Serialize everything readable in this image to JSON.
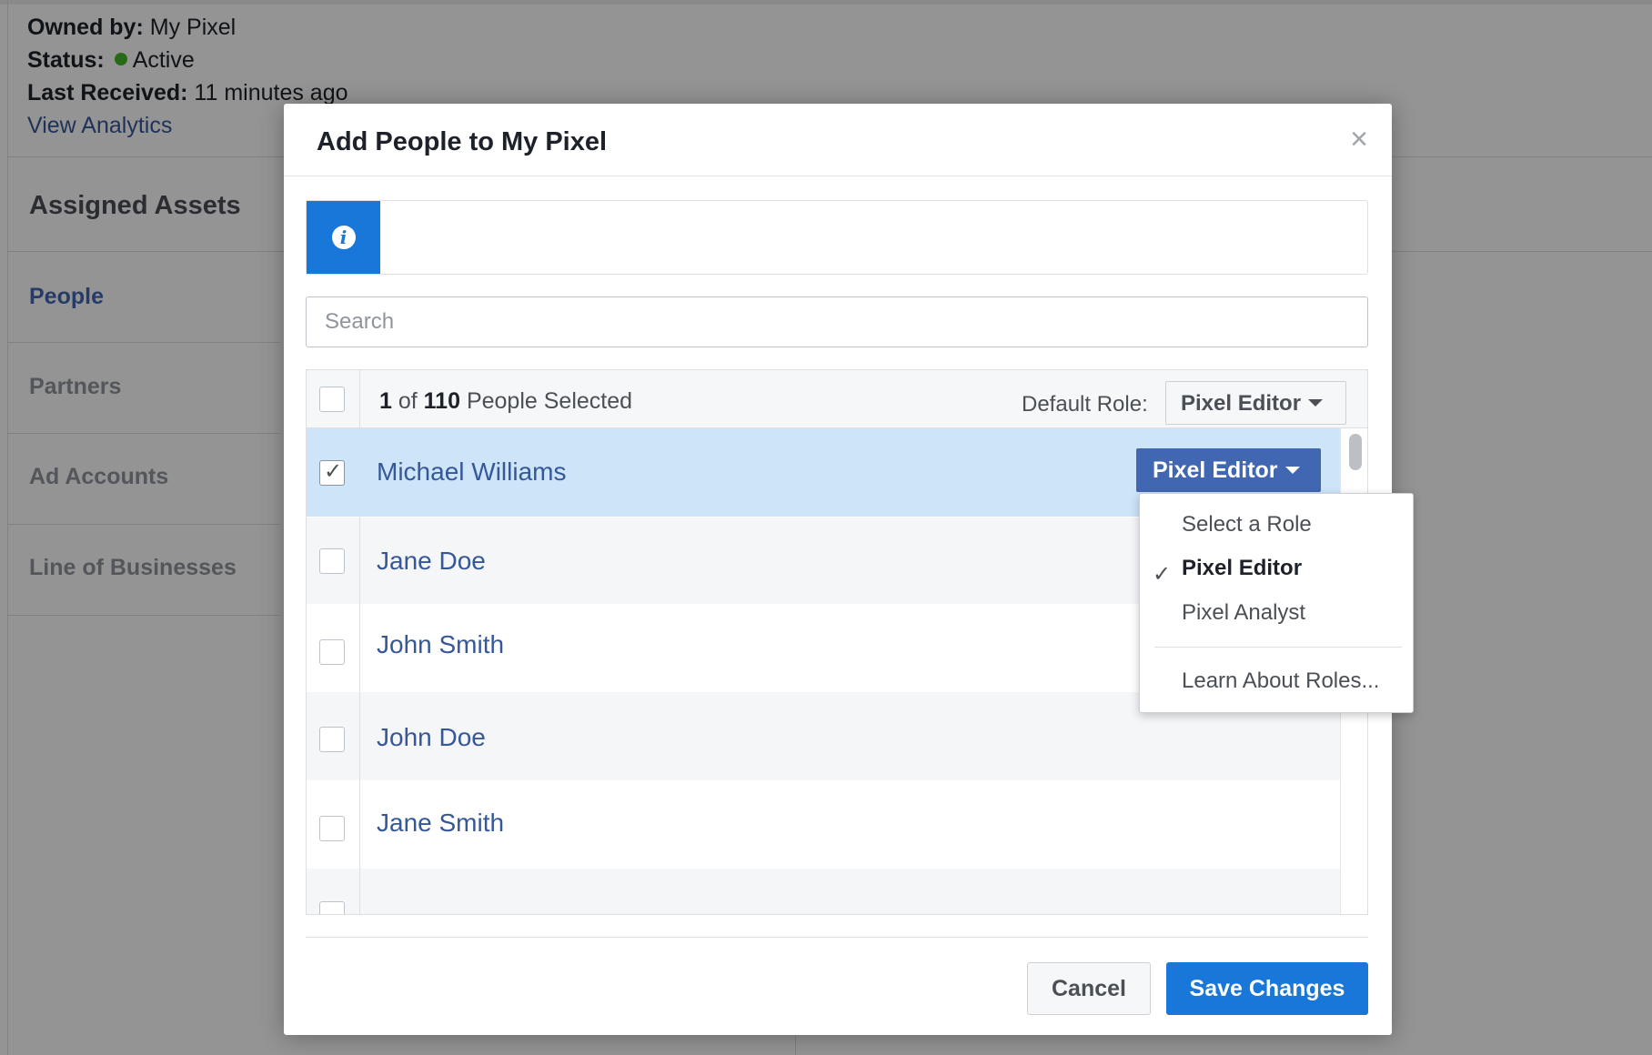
{
  "background": {
    "owned_by_label": "Owned by:",
    "owned_by_value": "My Pixel",
    "status_label": "Status:",
    "status_value": "Active",
    "last_received_label": "Last Received:",
    "last_received_value": "11 minutes ago",
    "view_analytics": "View Analytics",
    "assigned_assets_title": "Assigned Assets",
    "sidebar_items": [
      {
        "label": "People",
        "active": true
      },
      {
        "label": "Partners",
        "active": false
      },
      {
        "label": "Ad Accounts",
        "active": false
      },
      {
        "label": "Line of Businesses",
        "active": false
      }
    ]
  },
  "modal": {
    "title": "Add People to My Pixel",
    "close_glyph": "×",
    "notice_icon": "info-icon",
    "notice_text": "",
    "search_placeholder": "Search",
    "selection": {
      "selected_count": "1",
      "of_text": " of ",
      "total_count": "110",
      "suffix": " People Selected"
    },
    "default_role_label": "Default Role:",
    "default_role_value": "Pixel Editor",
    "people": [
      {
        "name": "Michael Williams",
        "checked": true,
        "role": "Pixel Editor"
      },
      {
        "name": "Jane Doe",
        "checked": false
      },
      {
        "name": "John Smith",
        "checked": false
      },
      {
        "name": "John Doe",
        "checked": false
      },
      {
        "name": "Jane Smith",
        "checked": false
      }
    ],
    "cancel_label": "Cancel",
    "save_label": "Save Changes"
  },
  "role_menu": {
    "items": [
      {
        "label": "Select a Role",
        "selected": false
      },
      {
        "label": "Pixel Editor",
        "selected": true
      },
      {
        "label": "Pixel Analyst",
        "selected": false
      }
    ],
    "learn_more": "Learn About Roles...",
    "check_glyph": "✓"
  },
  "colors": {
    "primary_blue": "#1877d8",
    "link_blue": "#365899",
    "selected_row": "#cde4f9",
    "role_button": "#4267b2",
    "status_active": "#42b72a"
  }
}
